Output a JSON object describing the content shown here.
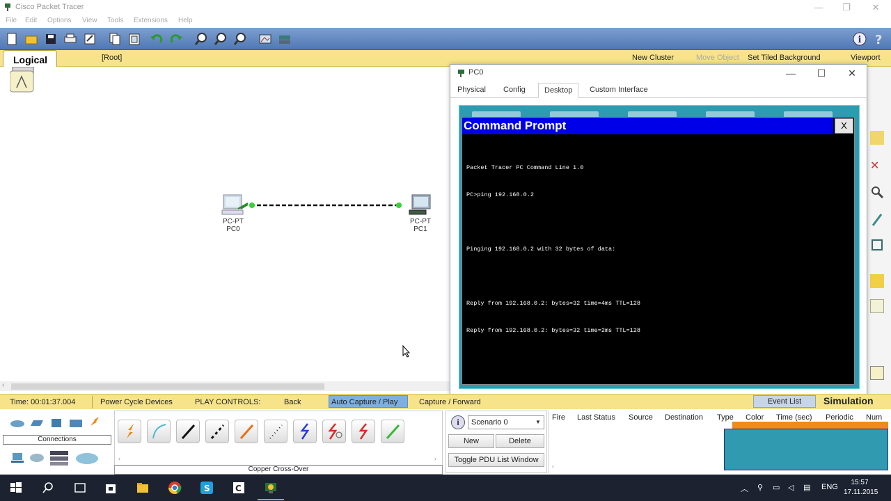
{
  "window": {
    "title": "Cisco Packet Tracer",
    "controls": [
      "—",
      "❐",
      "✕"
    ]
  },
  "menu": [
    "File",
    "Edit",
    "Options",
    "View",
    "Tools",
    "Extensions",
    "Help"
  ],
  "logical_bar": {
    "tab": "Logical",
    "root": "[Root]",
    "new_cluster": "New Cluster",
    "move_object": "Move Object",
    "set_tiled_bg": "Set Tiled Background",
    "viewport": "Viewport"
  },
  "devices": [
    {
      "type": "PC-PT",
      "name": "PC0"
    },
    {
      "type": "PC-PT",
      "name": "PC1"
    }
  ],
  "pc_window": {
    "title": "PC0",
    "controls": [
      "—",
      "☐",
      "✕"
    ],
    "tabs": [
      "Physical",
      "Config",
      "Desktop",
      "Custom Interface"
    ],
    "active_tab": "Desktop",
    "cmd": {
      "title": "Command Prompt",
      "close": "X",
      "lines": [
        "Packet Tracer PC Command Line 1.0",
        "PC>ping 192.168.0.2",
        "",
        "Pinging 192.168.0.2 with 32 bytes of data:",
        "",
        "Reply from 192.168.0.2: bytes=32 time=4ms TTL=128",
        "Reply from 192.168.0.2: bytes=32 time=2ms TTL=128"
      ]
    }
  },
  "control_bar": {
    "time": "Time: 00:01:37.004",
    "power_cycle": "Power Cycle Devices",
    "play_controls": "PLAY CONTROLS:",
    "back": "Back",
    "auto_capture": "Auto Capture / Play",
    "capture_forward": "Capture / Forward",
    "event_list": "Event List",
    "simulation": "Simulation"
  },
  "bottom": {
    "connections_label": "Connections",
    "copper_label": "Copper Cross-Over",
    "scenario": {
      "selected": "Scenario 0",
      "new": "New",
      "delete": "Delete",
      "toggle": "Toggle PDU List Window"
    },
    "pdu_headers": [
      "Fire",
      "Last Status",
      "Source",
      "Destination",
      "Type",
      "Color",
      "Time (sec)",
      "Periodic",
      "Num"
    ]
  },
  "taskbar": {
    "lang": "ENG",
    "time": "15:57",
    "date": "17.11.2015"
  },
  "colors": {
    "toolbar": "#5a82bd",
    "yellow_bar": "#f6e38a",
    "desktop_teal": "#2f9ab0",
    "cmd_title_blue": "#0000e8",
    "taskbar": "#1c2230"
  }
}
